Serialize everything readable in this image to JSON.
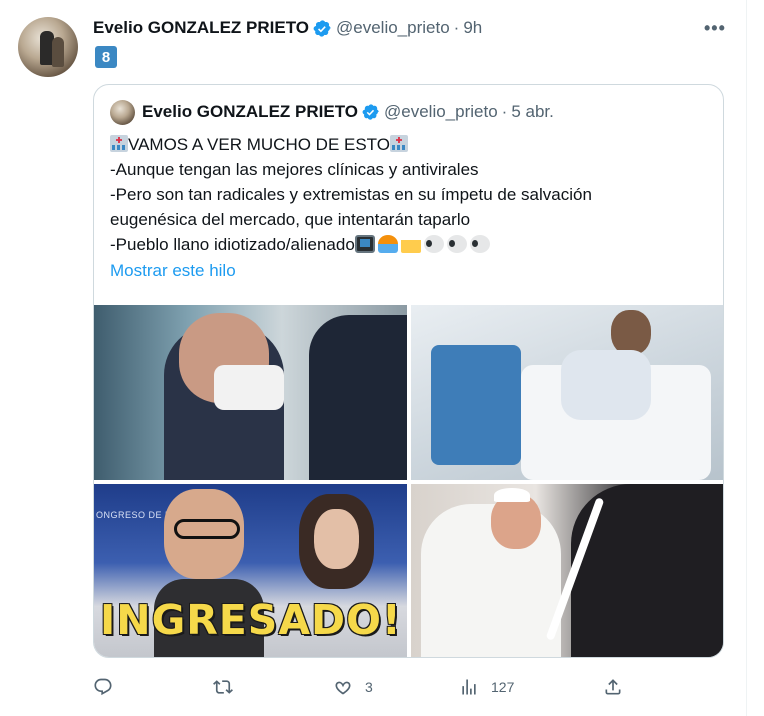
{
  "tweet": {
    "author_name": "Evelio GONZALEZ PRIETO",
    "handle": "@evelio_prieto",
    "separator": "·",
    "time": "9h",
    "more_label": "•••",
    "badge_text": "8"
  },
  "quote": {
    "author_name": "Evelio GONZALEZ PRIETO",
    "handle": "@evelio_prieto",
    "separator": "·",
    "time": "5 abr.",
    "lines": [
      "VAMOS A VER MUCHO DE ESTO",
      "-Aunque tengan las mejores clínicas y antivirales",
      "-Pero son tan radicales y extremistas en su ímpetu de salvación",
      "eugenésica del mercado, que intentarán taparlo",
      "-Pueblo llano idiotizado/alienado"
    ],
    "show_thread": "Mostrar este hilo",
    "image_texts": {
      "overlay_caption": "INGRESADO!",
      "background_sign": "ONGRESO DE LOS"
    }
  },
  "actions": {
    "reply_count": "",
    "retweet_count": "",
    "like_count": "3",
    "views_count": "127"
  },
  "icons": {
    "verified": "verified-badge-icon",
    "reply": "reply-icon",
    "retweet": "retweet-icon",
    "like": "heart-icon",
    "views": "views-icon",
    "share": "share-icon"
  },
  "colors": {
    "accent": "#1d9bf0",
    "secondary_text": "#536471",
    "border": "#cfd9de"
  }
}
